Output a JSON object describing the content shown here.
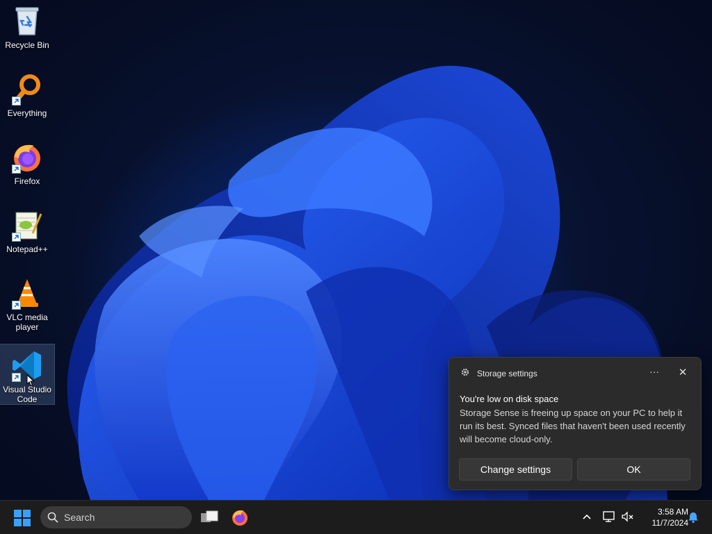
{
  "desktop_icons": [
    {
      "label": "Recycle Bin",
      "icon": "recycle-bin-icon"
    },
    {
      "label": "Everything",
      "icon": "everything-search-icon"
    },
    {
      "label": "Firefox",
      "icon": "firefox-icon"
    },
    {
      "label": "Notepad++",
      "icon": "notepad-plus-plus-icon"
    },
    {
      "label": "VLC media player",
      "icon": "vlc-icon"
    },
    {
      "label": "Visual Studio Code",
      "icon": "vscode-icon"
    }
  ],
  "toast": {
    "app_name": "Storage settings",
    "more_label": "···",
    "close_label": "✕",
    "title": "You're low on disk space",
    "body": "Storage Sense is freeing up space on your PC to help it run its best. Synced files that haven't been used recently will become cloud-only.",
    "change_settings_label": "Change settings",
    "ok_label": "OK"
  },
  "taskbar": {
    "search_placeholder": "Search",
    "tray_chevron": "^",
    "time": "3:58 AM",
    "date": "11/7/2024"
  },
  "colors": {
    "toast_bg": "#2b2b2b",
    "taskbar_bg": "#1c1c1c",
    "accent": "#0078d4"
  }
}
